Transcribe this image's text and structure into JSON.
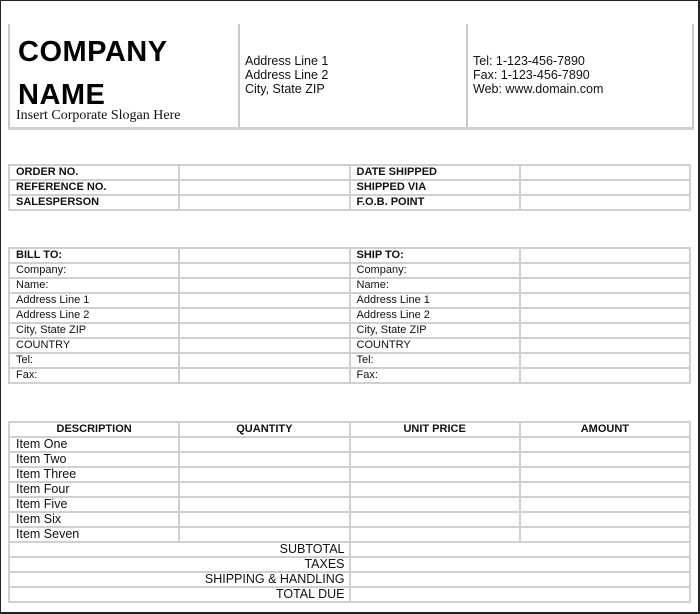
{
  "header": {
    "company_name_line1": "COMPANY",
    "company_name_line2": "NAME",
    "slogan": "Insert Corporate Slogan Here",
    "address": [
      "Address Line 1",
      "Address Line 2",
      "City, State ZIP"
    ],
    "contact": [
      "Tel: 1-123-456-7890",
      "Fax: 1-123-456-7890",
      "Web: www.domain.com"
    ]
  },
  "order_info": {
    "left_labels": [
      "ORDER NO.",
      "REFERENCE NO.",
      "SALESPERSON"
    ],
    "right_labels": [
      "DATE SHIPPED",
      "SHIPPED VIA",
      "F.O.B. POINT"
    ]
  },
  "bill_to": {
    "title": "BILL TO:",
    "fields": [
      "Company:",
      "Name:",
      "Address Line 1",
      "Address Line 2",
      "City, State ZIP",
      "COUNTRY",
      "Tel:",
      "Fax:"
    ]
  },
  "ship_to": {
    "title": "SHIP TO:",
    "fields": [
      "Company:",
      "Name:",
      "Address Line 1",
      "Address Line 2",
      "City, State ZIP",
      "COUNTRY",
      "Tel:",
      "Fax:"
    ]
  },
  "items": {
    "columns": [
      "DESCRIPTION",
      "QUANTITY",
      "UNIT PRICE",
      "AMOUNT"
    ],
    "rows": [
      "Item One",
      "Item Two",
      "Item Three",
      "Item Four",
      "Item Five",
      "Item Six",
      "Item Seven"
    ],
    "totals": [
      "SUBTOTAL",
      "TAXES",
      "SHIPPING & HANDLING",
      "TOTAL DUE"
    ]
  }
}
